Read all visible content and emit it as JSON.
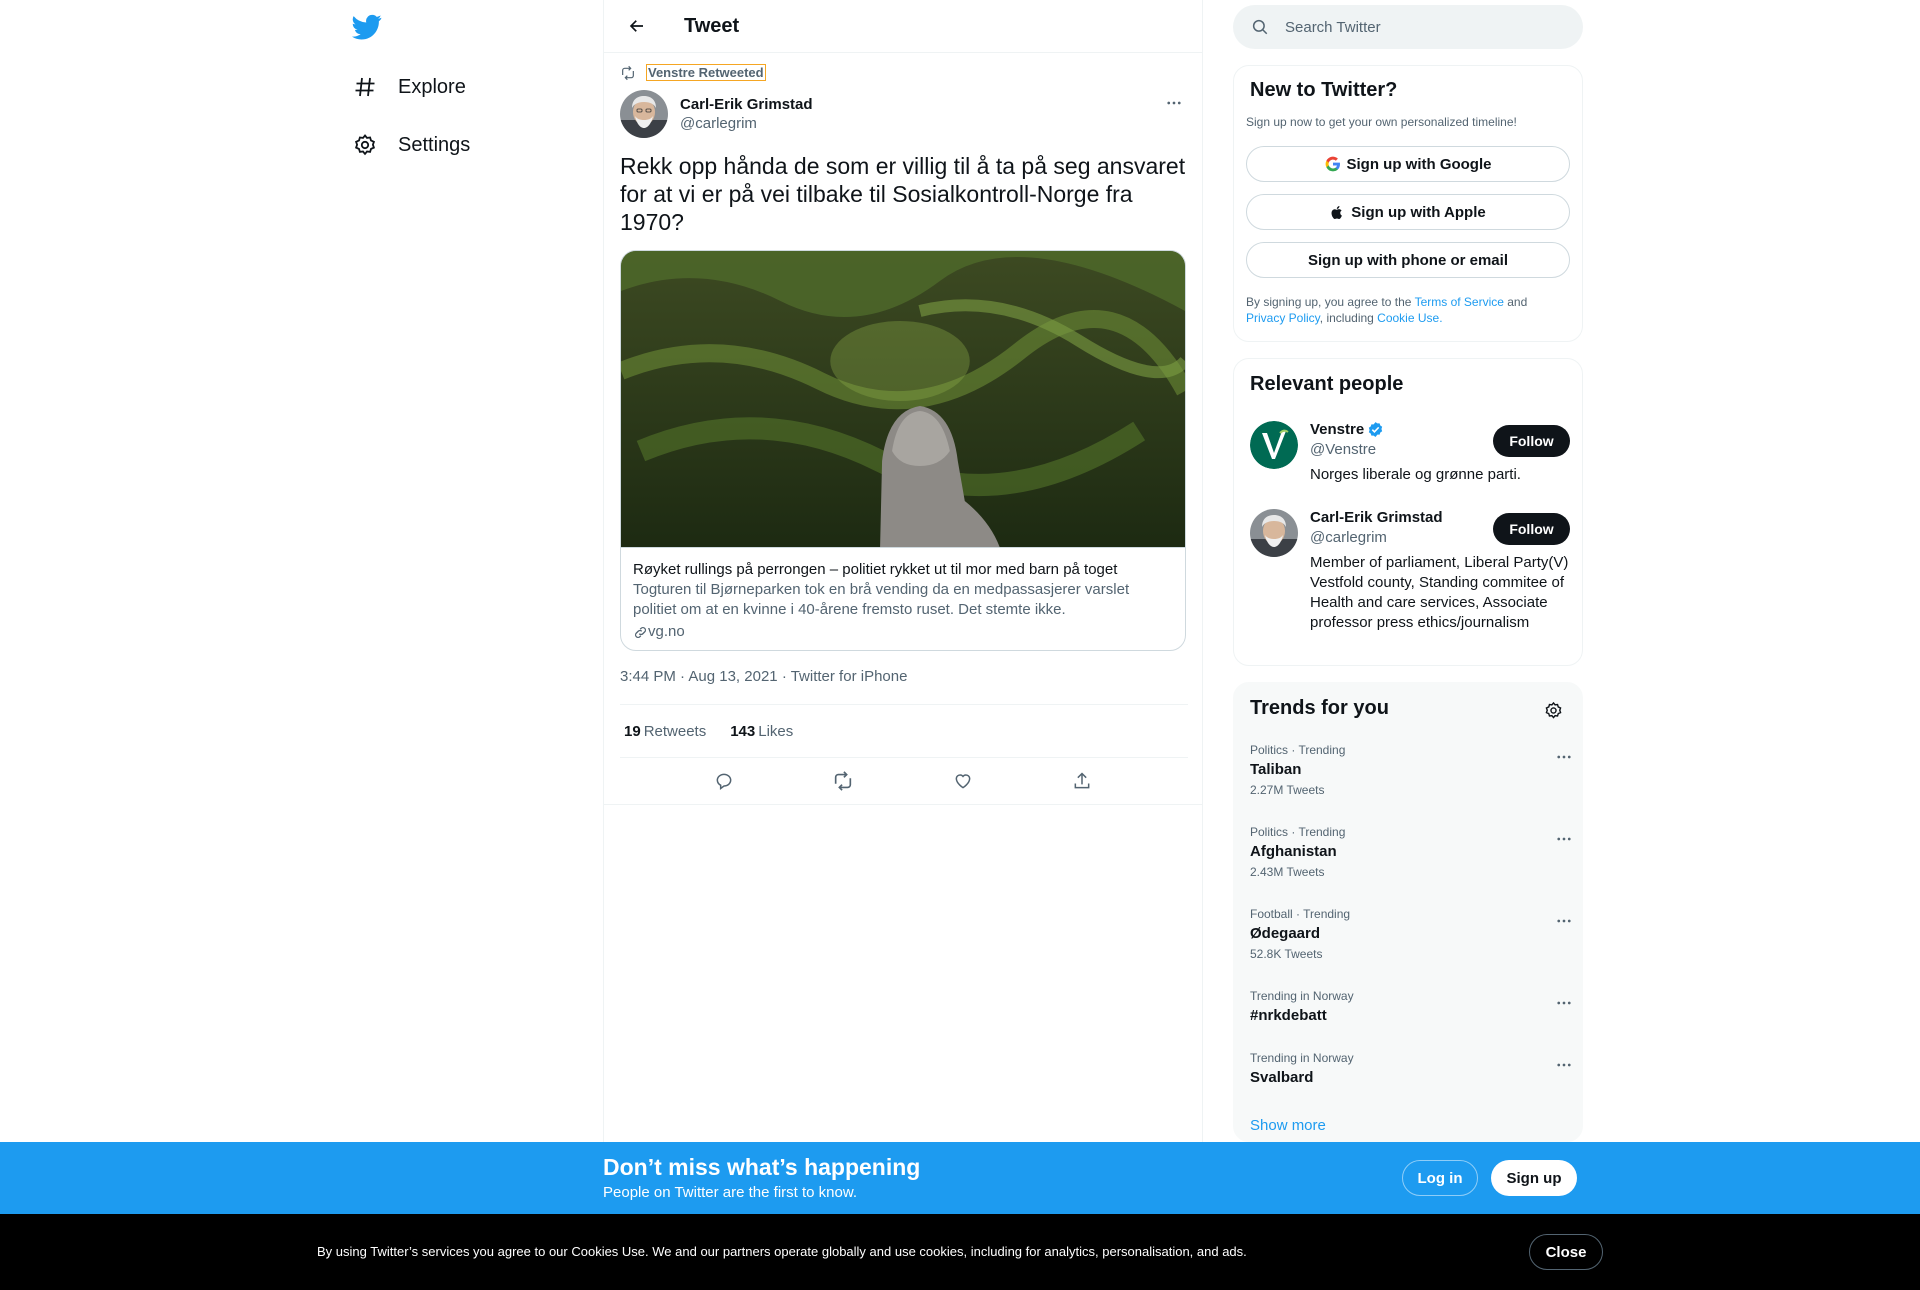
{
  "nav": {
    "explore_label": "Explore",
    "settings_label": "Settings"
  },
  "header": {
    "title": "Tweet"
  },
  "tweet": {
    "retweeted_by": "Venstre Retweeted",
    "author_name": "Carl-Erik Grimstad",
    "author_handle": "@carlegrim",
    "text": "Rekk opp hånda de som er villig til å ta på seg ansvaret for at vi er på vei tilbake til Sosialkontroll-Norge fra 1970?",
    "card": {
      "title": "Røyket rullings på perrongen – politiet rykket ut til mor med barn på toget",
      "description": "Togturen til Bjørneparken tok en brå vending da en medpassasjerer varslet politiet om at en kvinne i 40-årene fremsto ruset. Det stemte ikke.",
      "domain": "vg.no"
    },
    "time": "3:44 PM",
    "date": "Aug 13, 2021",
    "source": "Twitter for iPhone",
    "sep": "·",
    "retweets_count": "19",
    "retweets_label": "Retweets",
    "likes_count": "143",
    "likes_label": "Likes"
  },
  "search": {
    "placeholder": "Search Twitter"
  },
  "new_to_twitter": {
    "title": "New to Twitter?",
    "subtitle": "Sign up now to get your own personalized timeline!",
    "google_label": "Sign up with Google",
    "apple_label": "Sign up with Apple",
    "phone_label": "Sign up with phone or email",
    "legal_prefix": "By signing up, you agree to the ",
    "terms": "Terms of Service",
    "and": " and ",
    "privacy": "Privacy Policy",
    "including": ", including ",
    "cookie": "Cookie Use."
  },
  "relevant_people": {
    "title": "Relevant people",
    "people": [
      {
        "name": "Venstre",
        "handle": "@Venstre",
        "bio": "Norges liberale og grønne parti.",
        "follow": "Follow",
        "verified": true
      },
      {
        "name": "Carl-Erik Grimstad",
        "handle": "@carlegrim",
        "bio": "Member of parliament, Liberal Party(V) Vestfold county, Standing commitee of Health and care services, Associate professor press ethics/journalism",
        "follow": "Follow",
        "verified": false
      }
    ]
  },
  "trends": {
    "title": "Trends for you",
    "items": [
      {
        "context": "Politics · Trending",
        "name": "Taliban",
        "count": "2.27M Tweets"
      },
      {
        "context": "Politics · Trending",
        "name": "Afghanistan",
        "count": "2.43M Tweets"
      },
      {
        "context": "Football · Trending",
        "name": "Ødegaard",
        "count": "52.8K Tweets"
      },
      {
        "context": "Trending in Norway",
        "name": "#nrkdebatt",
        "count": ""
      },
      {
        "context": "Trending in Norway",
        "name": "Svalbard",
        "count": ""
      }
    ],
    "show_more": "Show more"
  },
  "banner": {
    "title": "Don’t miss what’s happening",
    "subtitle": "People on Twitter are the first to know.",
    "login": "Log in",
    "signup": "Sign up"
  },
  "cookie_bar": {
    "text": "By using Twitter’s services you agree to our Cookies Use. We and our partners operate globally and use cookies, including for analytics, personalisation, and ads.",
    "close": "Close"
  },
  "colors": {
    "accent": "#1d9bf0",
    "text": "#0f1419",
    "muted": "#536471",
    "border": "#eff3f4"
  }
}
